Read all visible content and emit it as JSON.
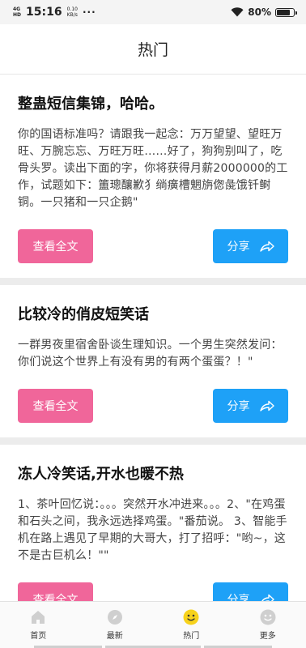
{
  "status_bar": {
    "network_top": "4G",
    "network_bottom": "HD",
    "time": "15:16",
    "speed_value": "0.10",
    "speed_unit": "KB/s",
    "dots": "···",
    "battery": "80%",
    "battery_level": 0.8
  },
  "header": {
    "title": "热门"
  },
  "cards": [
    {
      "title": "整蛊短信集锦，哈哈。",
      "body": "你的国语标准吗？请跟我一起念：万万望望、望旺万旺、万腕忘忘、万旺万旺……好了，狗狗别叫了，吃骨头罗。读出下面的字，你将获得月薪2000000的工作，试题如下：簠璁釀歉犭绱癀槽魍旃偬彘饿钎鲥铜。一只猪和一只企鹅\"",
      "read_label": "查看全文",
      "share_label": "分享"
    },
    {
      "title": "比较冷的俏皮短笑话",
      "body": "一群男夜里宿舍卧谈生理知识。一个男生突然发问：你们说这个世界上有没有男的有两个蛋蛋？！\"",
      "read_label": "查看全文",
      "share_label": "分享"
    },
    {
      "title": "冻人冷笑话,开水也暖不热",
      "body": "1、茶叶回忆说：。。。突然开水冲进来。。。2、\"在鸡蛋和石头之间，我永远选择鸡蛋。\"番茄说。 3、智能手机在路上遇见了早期的大哥大，打了招呼：\"哟~，这不是古巨机么！\"\"",
      "read_label": "查看全文",
      "share_label": "分享"
    }
  ],
  "tabbar": {
    "items": [
      {
        "label": "首页",
        "icon": "home-icon"
      },
      {
        "label": "最新",
        "icon": "compass-icon"
      },
      {
        "label": "热门",
        "icon": "hot-face-icon",
        "active": true
      },
      {
        "label": "更多",
        "icon": "more-face-icon"
      }
    ]
  },
  "colors": {
    "read_button": "#f0669a",
    "share_button": "#1ea1f7",
    "active_tab_icon": "#f7d21b",
    "inactive_tab_icon": "#cfcfcf"
  }
}
